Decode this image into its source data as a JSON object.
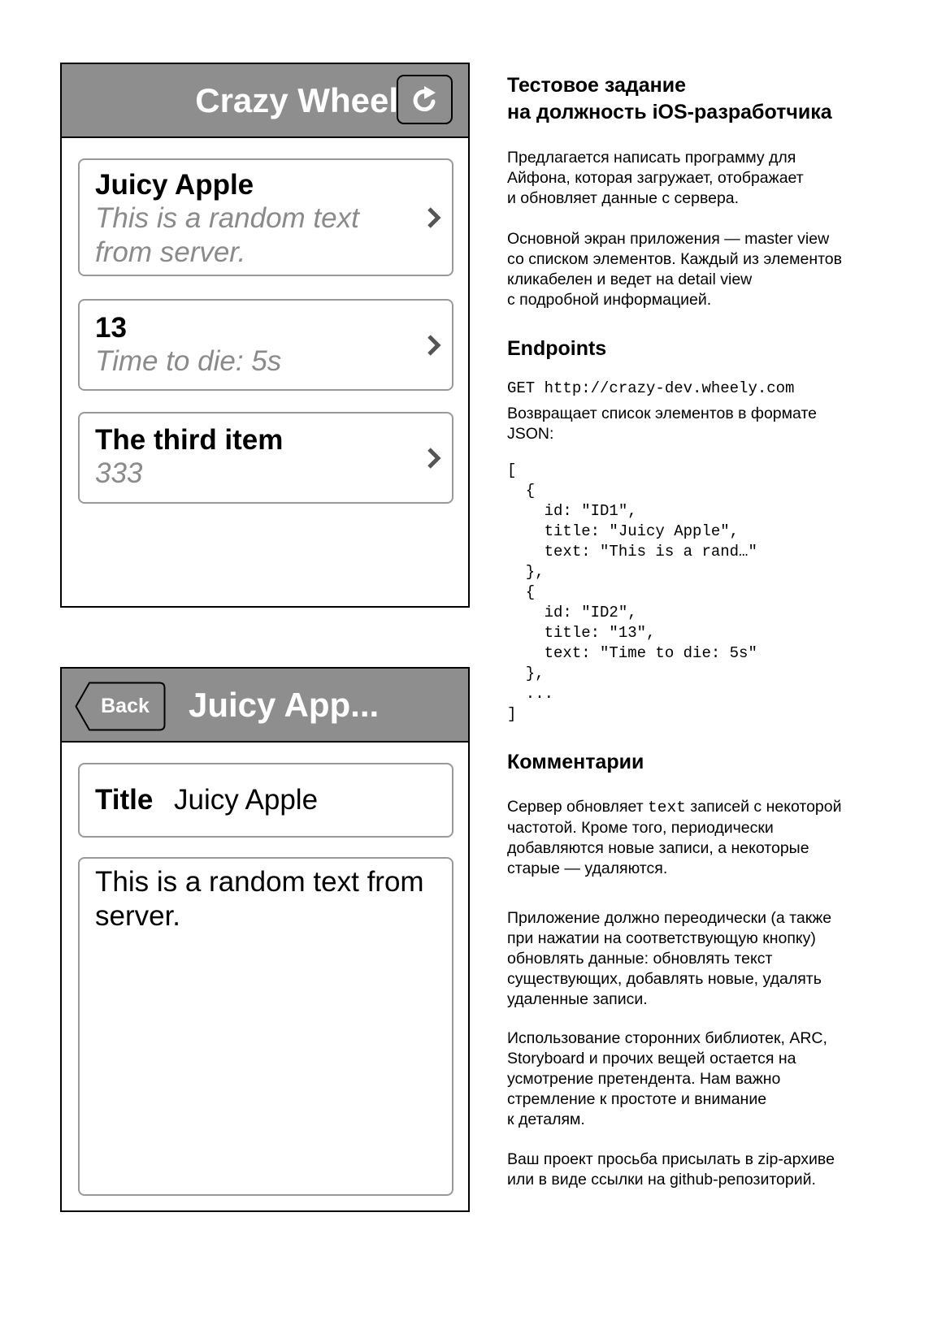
{
  "master": {
    "nav_title": "Crazy Wheel",
    "refresh_icon": "refresh-icon",
    "items": [
      {
        "title": "Juicy Apple",
        "text": "This is a random text from server."
      },
      {
        "title": "13",
        "text": "Time to die: 5s"
      },
      {
        "title": "The third item",
        "text": "333"
      }
    ]
  },
  "detail": {
    "back_label": "Back",
    "nav_title": "Juicy App...",
    "title_label": "Title",
    "title_value": "Juicy Apple",
    "body_text": "This is a random text from server."
  },
  "doc": {
    "heading_line1": "Тестовое задание",
    "heading_line2": "на должность iOS-разработчика",
    "intro_p1": "Предлагается написать программу для\nАйфона, которая загружает, отображает\nи обновляет данные с сервера.",
    "intro_p2": "Основной экран приложения — master view\nсо списком элементов. Каждый из элементов\nкликабелен и ведет на detail view\nс подробной информацией.",
    "endpoints_heading": "Endpoints",
    "endpoint": "GET http://crazy-dev.wheely.com",
    "endpoint_desc": "Возвращает список элементов в формате\nJSON:",
    "json_example": "[\n  {\n    id: \"ID1\",\n    title: \"Juicy Apple\",\n    text: \"This is a rand…\"\n  },\n  {\n    id: \"ID2\",\n    title: \"13\",\n    text: \"Time to die: 5s\"\n  },\n  ...\n]",
    "comments_heading": "Комментарии",
    "comment1_before": "Сервер обновляет ",
    "comment1_code": "text",
    "comment1_after": " записей с некоторой\nчастотой. Кроме того, периодически\nдобавляются новые записи, а некоторые\nстарые — удаляются.",
    "comment2": "Приложение должно переодически (а также\nпри нажатии на соответствующую кнопку)\nобновлять данные: обновлять текст\nсуществующих, добавлять новые, удалять\nудаленные записи.",
    "comment3": "Использование сторонних библиотек, ARC,\nStoryboard и прочих вещей остается на\nусмотрение претендента. Нам важно\nстремление к простоте и внимание\nк деталям.",
    "comment4": "Ваш проект просьба присылать в zip-архиве\nили в виде ссылки на github-репозиторий."
  }
}
